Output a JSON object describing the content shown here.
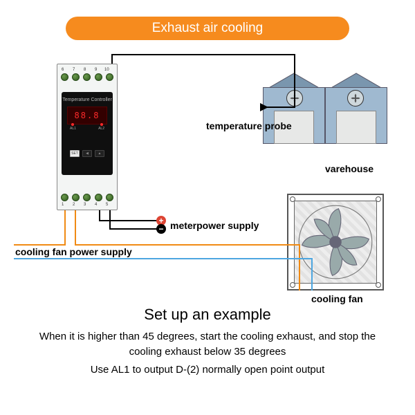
{
  "banner": {
    "title": "Exhaust air cooling"
  },
  "controller": {
    "label": "Temperature Controller",
    "display": "88.8",
    "buttons": {
      "set": "SET",
      "left": "◀",
      "right": "▲"
    },
    "leds": {
      "al1": "AL1",
      "al2": "AL2"
    },
    "top_terminals": [
      "6",
      "7",
      "8",
      "9",
      "10"
    ],
    "bot_terminals": [
      "1",
      "2",
      "3",
      "4",
      "5"
    ]
  },
  "labels": {
    "probe": "temperature probe",
    "warehouse": "varehouse",
    "meter": "meterpower supply",
    "fan_supply": "cooling fan power supply",
    "fan": "cooling fan"
  },
  "polarity": {
    "plus": "+",
    "minus": "−"
  },
  "example": {
    "title": "Set up an example",
    "line1": "When it is higher than 45 degrees, start the cooling exhaust, and stop the cooling exhaust below 35 degrees",
    "line2": "Use AL1 to output D-(2) normally open point output"
  },
  "colors": {
    "accent": "#f68b1e",
    "wire_orange": "#f08a13",
    "wire_blue": "#4da6e0"
  }
}
